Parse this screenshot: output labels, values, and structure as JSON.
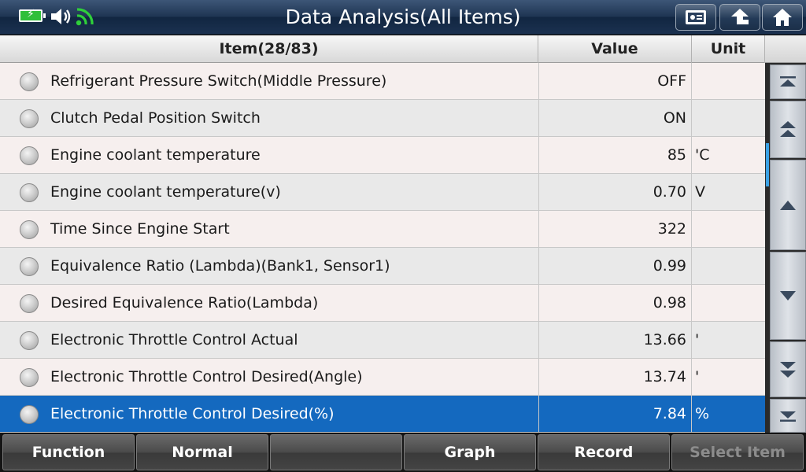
{
  "titlebar": {
    "title": "Data Analysis(All Items)",
    "status_icons": [
      "battery-charging-icon",
      "speaker-icon",
      "wifi-icon"
    ],
    "buttons": [
      "display-icon",
      "back-arrow-icon",
      "home-icon"
    ]
  },
  "table": {
    "headers": {
      "item": "Item(28/83)",
      "value": "Value",
      "unit": "Unit"
    },
    "rows": [
      {
        "name": "Refrigerant Pressure Switch(Middle Pressure)",
        "value": "OFF",
        "unit": ""
      },
      {
        "name": "Clutch Pedal Position Switch",
        "value": "ON",
        "unit": ""
      },
      {
        "name": "Engine coolant temperature",
        "value": "85",
        "unit": "'C"
      },
      {
        "name": "Engine coolant temperature(v)",
        "value": "0.70",
        "unit": "V"
      },
      {
        "name": "Time Since Engine Start",
        "value": "322",
        "unit": ""
      },
      {
        "name": "Equivalence Ratio (Lambda)(Bank1, Sensor1)",
        "value": "0.99",
        "unit": ""
      },
      {
        "name": "Desired Equivalence Ratio(Lambda)",
        "value": "0.98",
        "unit": ""
      },
      {
        "name": "Electronic Throttle Control Actual",
        "value": "13.66",
        "unit": "'"
      },
      {
        "name": "Electronic Throttle Control Desired(Angle)",
        "value": "13.74",
        "unit": "'"
      },
      {
        "name": "Electronic Throttle Control Desired(%)",
        "value": "7.84",
        "unit": "%"
      }
    ],
    "selected_row": 9,
    "selected_color": "#1469bf"
  },
  "scrollbar": {
    "buttons": [
      "scroll-top-icon",
      "page-up-icon",
      "scroll-up-icon",
      "scroll-down-icon",
      "page-down-icon",
      "scroll-bottom-icon"
    ]
  },
  "bottombar": {
    "function_label": "Function",
    "normal_label": "Normal",
    "blank_label": "",
    "graph_label": "Graph",
    "record_label": "Record",
    "select_item_label": "Select Item"
  }
}
